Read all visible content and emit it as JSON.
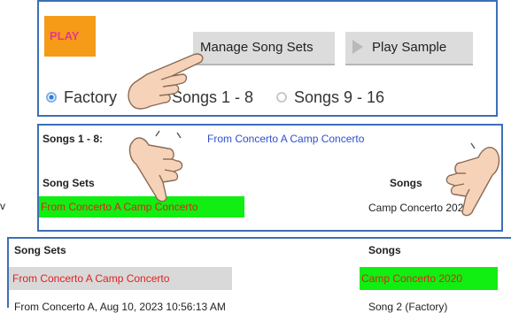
{
  "panel1": {
    "play_label": "PLAY",
    "manage_label": "Manage Song Sets",
    "sample_label": "Play Sample",
    "radios": [
      {
        "label": "Factory",
        "checked": true
      },
      {
        "label": "Songs 1 - 8",
        "checked": false
      },
      {
        "label": "Songs 9 - 16",
        "checked": false
      }
    ]
  },
  "panel2": {
    "range_label": "Songs 1 - 8:",
    "current_set": "From Concerto A Camp Concerto",
    "sets_header": "Song Sets",
    "songs_header": "Songs",
    "selected_set": "From Concerto A Camp Concerto",
    "selected_song": "Camp Concerto 2020"
  },
  "panel3": {
    "sets_header": "Song Sets",
    "songs_header": "Songs",
    "selected_set": "From Concerto A Camp Concerto",
    "selected_song": "Camp Concerto 2020",
    "cut_left": "From Concerto A, Aug 10, 2023 10:56:13 AM",
    "cut_right": "Song 2 (Factory)"
  },
  "stray_char": "v",
  "colors": {
    "panel_border": "#3d6fb5",
    "play_bg": "#f59b18",
    "play_text": "#e23a8a",
    "highlight_green": "#11ee11",
    "highlight_gray": "#d9d9d9",
    "red_text": "#e41e1e",
    "link_blue": "#2f4fd1"
  },
  "icons": [
    "play-triangle-icon",
    "pointing-hand-icon"
  ]
}
